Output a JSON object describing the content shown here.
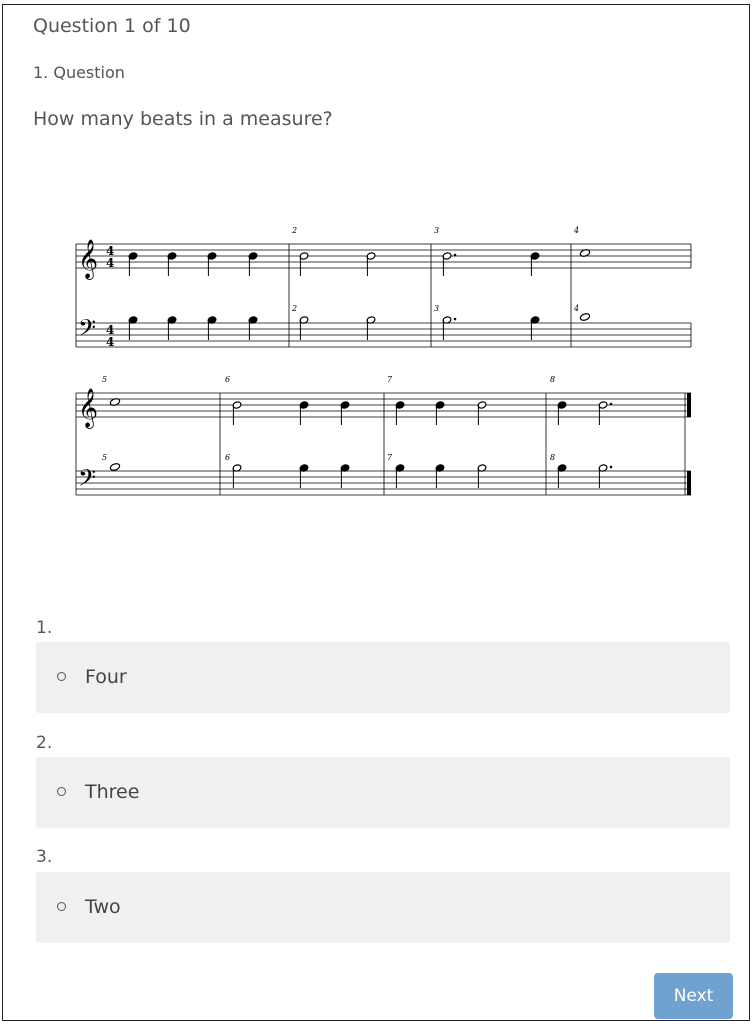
{
  "quiz": {
    "counter": "Question 1 of 10",
    "question_number": "1. Question",
    "prompt": "How many beats in a measure?"
  },
  "score": {
    "time_signature": {
      "top": "4",
      "bottom": "4"
    },
    "measure_numbers": [
      "2",
      "3",
      "4",
      "5",
      "6",
      "7",
      "8"
    ]
  },
  "options": [
    {
      "number": "1.",
      "label": "Four"
    },
    {
      "number": "2.",
      "label": "Three"
    },
    {
      "number": "3.",
      "label": "Two"
    }
  ],
  "footer": {
    "next_label": "Next"
  },
  "colors": {
    "accent": "#6fa1d1",
    "option_bg": "#f0f0f0",
    "text": "#555555"
  }
}
